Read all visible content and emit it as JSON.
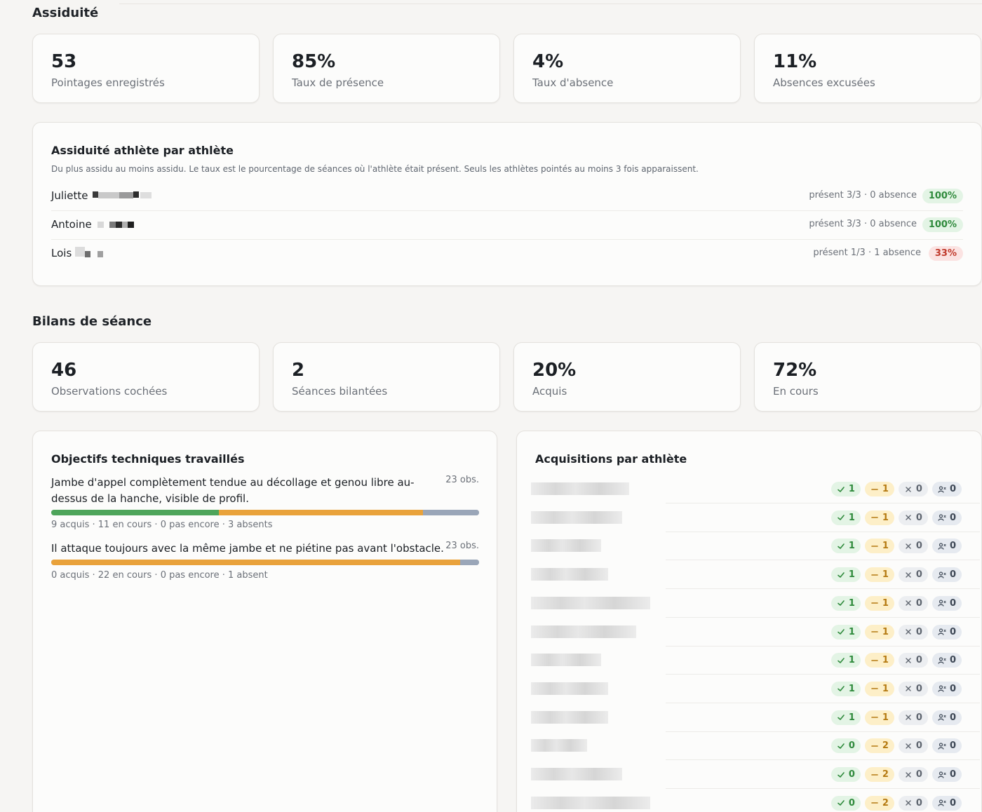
{
  "attendance": {
    "title": "Assiduité",
    "stats": [
      {
        "value": "53",
        "label": "Pointages enregistrés"
      },
      {
        "value": "85%",
        "label": "Taux de présence"
      },
      {
        "value": "4%",
        "label": "Taux d'absence"
      },
      {
        "value": "11%",
        "label": "Absences excusées"
      }
    ],
    "per_athlete": {
      "title": "Assiduité athlète par athlète",
      "subtitle": "Du plus assidu au moins assidu. Le taux est le pourcentage de séances où l'athlète était présent. Seuls les athlètes pointés au moins 3 fois apparaissent.",
      "rows": [
        {
          "name": "Juliette",
          "detail": "présent 3/3 · 0 absence",
          "rate": "100%",
          "status": "green"
        },
        {
          "name": "Antoine",
          "detail": "présent 3/3 · 0 absence",
          "rate": "100%",
          "status": "green"
        },
        {
          "name": "Lois",
          "detail": "présent 1/3 · 1 absence",
          "rate": "33%",
          "status": "red"
        }
      ]
    }
  },
  "session_reviews": {
    "title": "Bilans de séance",
    "stats": [
      {
        "value": "46",
        "label": "Observations cochées"
      },
      {
        "value": "2",
        "label": "Séances bilantées"
      },
      {
        "value": "20%",
        "label": "Acquis"
      },
      {
        "value": "72%",
        "label": "En cours"
      }
    ],
    "objectives": {
      "title": "Objectifs techniques travaillés",
      "items": [
        {
          "text": "Jambe d'appel complètement tendue au décollage et genou libre au-dessus de la hanche, visible de profil.",
          "count": "23 obs.",
          "stats": "9 acquis · 11 en cours · 0 pas encore · 3 absents",
          "acquired": 9,
          "in_progress": 11,
          "not_yet": 0,
          "absent": 3
        },
        {
          "text": "Il attaque toujours avec la même jambe et ne piétine pas avant l'obstacle.",
          "count": "23 obs.",
          "stats": "0 acquis · 22 en cours · 0 pas encore · 1 absent",
          "acquired": 0,
          "in_progress": 22,
          "not_yet": 0,
          "absent": 1
        }
      ]
    },
    "acquisitions": {
      "title": "Acquisitions par athlète",
      "rows": [
        {
          "acquired": "1",
          "in_progress": "1",
          "not_yet": "0",
          "absent": "0"
        },
        {
          "acquired": "1",
          "in_progress": "1",
          "not_yet": "0",
          "absent": "0"
        },
        {
          "acquired": "1",
          "in_progress": "1",
          "not_yet": "0",
          "absent": "0"
        },
        {
          "acquired": "1",
          "in_progress": "1",
          "not_yet": "0",
          "absent": "0"
        },
        {
          "acquired": "1",
          "in_progress": "1",
          "not_yet": "0",
          "absent": "0"
        },
        {
          "acquired": "1",
          "in_progress": "1",
          "not_yet": "0",
          "absent": "0"
        },
        {
          "acquired": "1",
          "in_progress": "1",
          "not_yet": "0",
          "absent": "0"
        },
        {
          "acquired": "1",
          "in_progress": "1",
          "not_yet": "0",
          "absent": "0"
        },
        {
          "acquired": "1",
          "in_progress": "1",
          "not_yet": "0",
          "absent": "0"
        },
        {
          "acquired": "0",
          "in_progress": "2",
          "not_yet": "0",
          "absent": "0"
        },
        {
          "acquired": "0",
          "in_progress": "2",
          "not_yet": "0",
          "absent": "0"
        },
        {
          "acquired": "0",
          "in_progress": "2",
          "not_yet": "0",
          "absent": "0"
        }
      ]
    }
  }
}
